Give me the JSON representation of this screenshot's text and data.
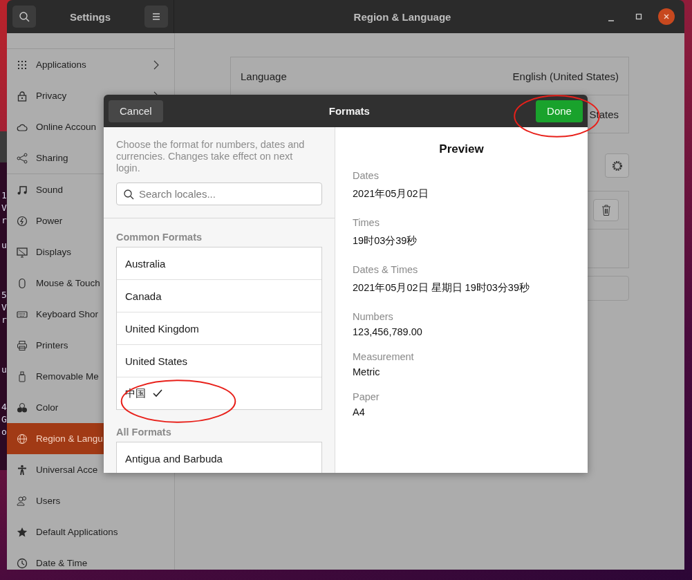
{
  "terminal": {
    "blocks": [
      [
        "1",
        "V",
        "r"
      ],
      [
        "u"
      ],
      [
        "5",
        "V",
        "r"
      ],
      [
        "u"
      ],
      [
        "4",
        "G",
        "o"
      ]
    ]
  },
  "header": {
    "title": "Settings",
    "page_title": "Region & Language"
  },
  "sidebar": {
    "items": [
      {
        "label": "Applications",
        "kind": "grid",
        "selected": false,
        "chevron": true
      },
      {
        "label": "Privacy",
        "kind": "lock",
        "selected": false,
        "chevron": true
      },
      {
        "label": "Online Accoun",
        "kind": "cloud",
        "selected": false
      },
      {
        "label": "Sharing",
        "kind": "share",
        "selected": false,
        "divider_after": true
      },
      {
        "label": "Sound",
        "kind": "note",
        "selected": false
      },
      {
        "label": "Power",
        "kind": "power",
        "selected": false
      },
      {
        "label": "Displays",
        "kind": "display",
        "selected": false
      },
      {
        "label": "Mouse & Touch",
        "kind": "mouse",
        "selected": false
      },
      {
        "label": "Keyboard Shor",
        "kind": "keyboard",
        "selected": false
      },
      {
        "label": "Printers",
        "kind": "printer",
        "selected": false
      },
      {
        "label": "Removable Me",
        "kind": "usb",
        "selected": false
      },
      {
        "label": "Color",
        "kind": "color",
        "selected": false
      },
      {
        "label": "Region & Langu",
        "kind": "globe",
        "selected": true
      },
      {
        "label": "Universal Acce",
        "kind": "person",
        "selected": false
      },
      {
        "label": "Users",
        "kind": "users",
        "selected": false
      },
      {
        "label": "Default Applications",
        "kind": "star",
        "selected": false
      },
      {
        "label": "Date & Time",
        "kind": "clock",
        "selected": false
      }
    ]
  },
  "region_panel": {
    "rows": [
      {
        "label": "Language",
        "value": "English (United States)"
      },
      {
        "value": "States"
      }
    ]
  },
  "dialog": {
    "title": "Formats",
    "cancel": "Cancel",
    "done": "Done",
    "done_circled": true,
    "description": "Choose the format for numbers, dates and currencies. Changes take effect on next login.",
    "search_placeholder": "Search locales...",
    "common_heading": "Common Formats",
    "common": [
      {
        "name": "Australia",
        "selected": false,
        "circled": false
      },
      {
        "name": "Canada",
        "selected": false,
        "circled": false
      },
      {
        "name": "United Kingdom",
        "selected": false,
        "circled": false
      },
      {
        "name": "United States",
        "selected": false,
        "circled": false
      },
      {
        "name": "中国",
        "selected": true,
        "circled": true
      }
    ],
    "all_heading": "All Formats",
    "all": [
      {
        "name": "Antigua and Barbuda",
        "selected": false,
        "circled": false
      }
    ],
    "preview": {
      "title": "Preview",
      "items": [
        {
          "label": "Dates",
          "value": "2021年05月02日"
        },
        {
          "label": "Times",
          "value": "19时03分39秒"
        },
        {
          "label": "Dates & Times",
          "value": "2021年05月02日 星期日 19时03分39秒"
        },
        {
          "label": "Numbers",
          "value": "123,456,789.00"
        },
        {
          "label": "Measurement",
          "value": "Metric"
        },
        {
          "label": "Paper",
          "value": "A4"
        }
      ]
    }
  }
}
